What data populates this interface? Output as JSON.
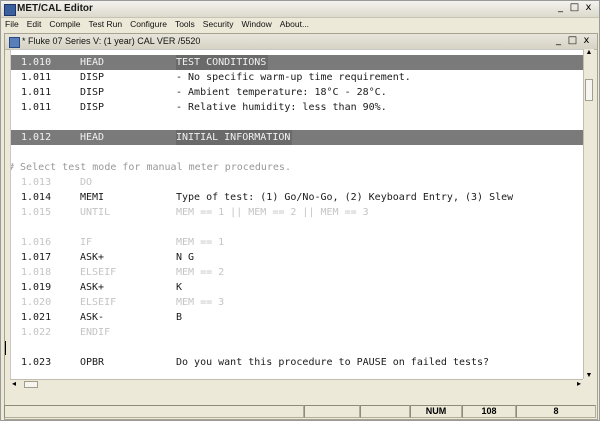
{
  "app": {
    "title": "MET/CAL Editor",
    "window_buttons": [
      "_",
      "□",
      "x"
    ]
  },
  "menubar": [
    "File",
    "Edit",
    "Compile",
    "Test Run",
    "Configure",
    "Tools",
    "Security",
    "Window",
    "About..."
  ],
  "document": {
    "title": "* Fluke 07 Series V: (1 year) CAL VER /5520",
    "window_buttons": [
      "_",
      "□",
      "x"
    ]
  },
  "editor": {
    "lines": [
      {
        "style": "head",
        "num": "1.010",
        "kw": "HEAD",
        "text": "TEST CONDITIONS"
      },
      {
        "style": "normal",
        "num": "1.011",
        "kw": "DISP",
        "text": "- No specific warm-up time requirement."
      },
      {
        "style": "normal",
        "num": "1.011",
        "kw": "DISP",
        "text": "- Ambient temperature: 18°C - 28°C."
      },
      {
        "style": "normal",
        "num": "1.011",
        "kw": "DISP",
        "text": "- Relative humidity: less than 90%."
      },
      {
        "style": "blank",
        "num": "",
        "kw": "",
        "text": ""
      },
      {
        "style": "head",
        "num": "1.012",
        "kw": "HEAD",
        "text": "INITIAL INFORMATION"
      },
      {
        "style": "blank",
        "num": "",
        "kw": "",
        "text": ""
      },
      {
        "style": "comment",
        "num": "",
        "kw": "",
        "text": "# Select test mode for manual meter procedures."
      },
      {
        "style": "dim",
        "num": "1.013",
        "kw": "DO",
        "text": ""
      },
      {
        "style": "normal",
        "num": "1.014",
        "kw": "MEMI",
        "text": "Type of test: (1) Go/No-Go, (2) Keyboard Entry, (3) Slew"
      },
      {
        "style": "dim",
        "num": "1.015",
        "kw": "UNTIL",
        "text": "MEM == 1 || MEM == 2 || MEM == 3"
      },
      {
        "style": "blank",
        "num": "",
        "kw": "",
        "text": ""
      },
      {
        "style": "dim",
        "num": "1.016",
        "kw": "IF",
        "text": "MEM == 1"
      },
      {
        "style": "normal",
        "num": "1.017",
        "kw": "ASK+",
        "text": "N G"
      },
      {
        "style": "dim",
        "num": "1.018",
        "kw": "ELSEIF",
        "text": "MEM == 2"
      },
      {
        "style": "normal",
        "num": "1.019",
        "kw": "ASK+",
        "text": "K"
      },
      {
        "style": "dim",
        "num": "1.020",
        "kw": "ELSEIF",
        "text": "MEM == 3"
      },
      {
        "style": "normal",
        "num": "1.021",
        "kw": "ASK-",
        "text": "B"
      },
      {
        "style": "dim",
        "num": "1.022",
        "kw": "ENDIF",
        "text": ""
      },
      {
        "style": "blank",
        "num": "",
        "kw": "",
        "text": ""
      },
      {
        "style": "normal",
        "num": "1.023",
        "kw": "OPBR",
        "text": "Do you want this procedure to PAUSE on failed tests?"
      }
    ]
  },
  "statusbar": {
    "num": "NUM",
    "line": "108",
    "col": "8"
  }
}
